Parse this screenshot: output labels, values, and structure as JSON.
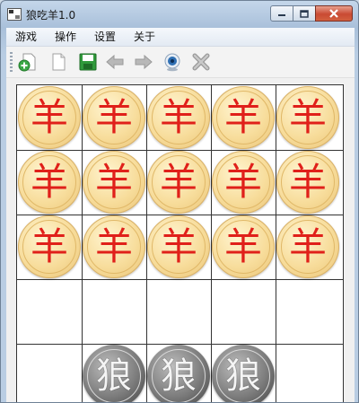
{
  "window": {
    "title": "狼吃羊1.0"
  },
  "menu": [
    "游戏",
    "操作",
    "设置",
    "关于"
  ],
  "toolbar": [
    {
      "icon": "new-game-icon"
    },
    {
      "icon": "blank-document-icon"
    },
    {
      "icon": "save-icon"
    },
    {
      "icon": "undo-arrow-icon"
    },
    {
      "icon": "redo-arrow-icon"
    },
    {
      "icon": "camera-icon"
    },
    {
      "icon": "close-x-icon"
    }
  ],
  "board": {
    "rows": 5,
    "cols": 5,
    "sheep_label": "羊",
    "wolf_label": "狼",
    "sheep": [
      [
        0,
        0
      ],
      [
        0,
        1
      ],
      [
        0,
        2
      ],
      [
        0,
        3
      ],
      [
        0,
        4
      ],
      [
        1,
        0
      ],
      [
        1,
        1
      ],
      [
        1,
        2
      ],
      [
        1,
        3
      ],
      [
        1,
        4
      ],
      [
        2,
        0
      ],
      [
        2,
        1
      ],
      [
        2,
        2
      ],
      [
        2,
        3
      ],
      [
        2,
        4
      ]
    ],
    "wolves": [
      [
        4,
        1
      ],
      [
        4,
        2
      ],
      [
        4,
        3
      ]
    ]
  },
  "colors": {
    "sheep_text": "#e0201a",
    "sheep_fill": "#f7dc9a",
    "wolf_fill": "#7b7b7b",
    "grid": "#333333"
  }
}
